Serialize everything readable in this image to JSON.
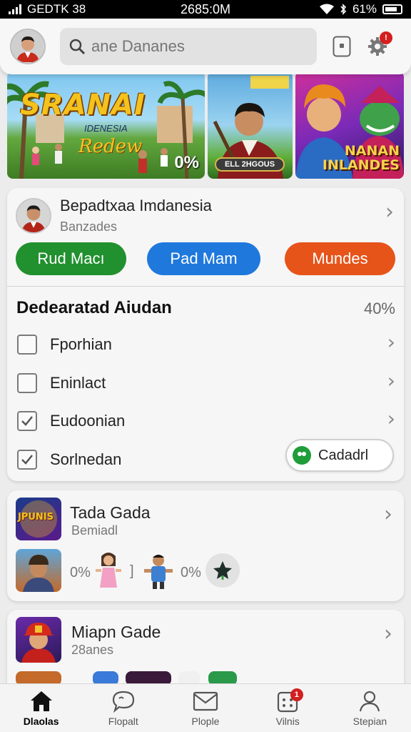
{
  "status_bar": {
    "carrier": "GEDTK 38",
    "time": "2685:0M",
    "battery": "61%"
  },
  "header": {
    "search_placeholder": "ane Dananes",
    "notification_count": "!"
  },
  "banners": [
    {
      "title": "SRANAI",
      "subtitle": "IDENESIA",
      "script": "Redew",
      "percent": "0%"
    },
    {
      "label": "ELL 2HGOUS"
    },
    {
      "text_line1": "NANAN",
      "text_line2": "INLANDES"
    }
  ],
  "profile_card": {
    "name": "Bepadtxaa Imdanesia",
    "subtitle": "Banzades",
    "buttons": [
      "Rud Macı",
      "Pad Mam",
      "Mundes"
    ],
    "section_title": "Dedearatad Aiudan",
    "section_percent": "40%",
    "checklist": [
      {
        "label": "Fporhian",
        "checked": false
      },
      {
        "label": "Eninlact",
        "checked": false
      },
      {
        "label": "Eudoonian",
        "checked": true
      },
      {
        "label": "Sorlnedan",
        "checked": true
      }
    ],
    "action_button": "Cadadrl"
  },
  "game_card_1": {
    "title": "Tada Gada",
    "subtitle": "Bemiadl",
    "thumb_text": "JPUNIS",
    "percent_a": "0%",
    "bracket": "]",
    "percent_b": "0%"
  },
  "game_card_2": {
    "title": "Miapn Gade",
    "subtitle": "28anes"
  },
  "nav": {
    "items": [
      {
        "label": "Dlaolas",
        "icon": "home-icon"
      },
      {
        "label": "Flopalt",
        "icon": "chat-icon"
      },
      {
        "label": "Plople",
        "icon": "mail-icon"
      },
      {
        "label": "Vilnis",
        "icon": "calendar-icon",
        "badge": "1"
      },
      {
        "label": "Stepian",
        "icon": "person-icon"
      }
    ]
  },
  "colors": {
    "green": "#21902e",
    "blue": "#1f78dc",
    "orange": "#e6541a",
    "badge_red": "#d31f1f"
  }
}
